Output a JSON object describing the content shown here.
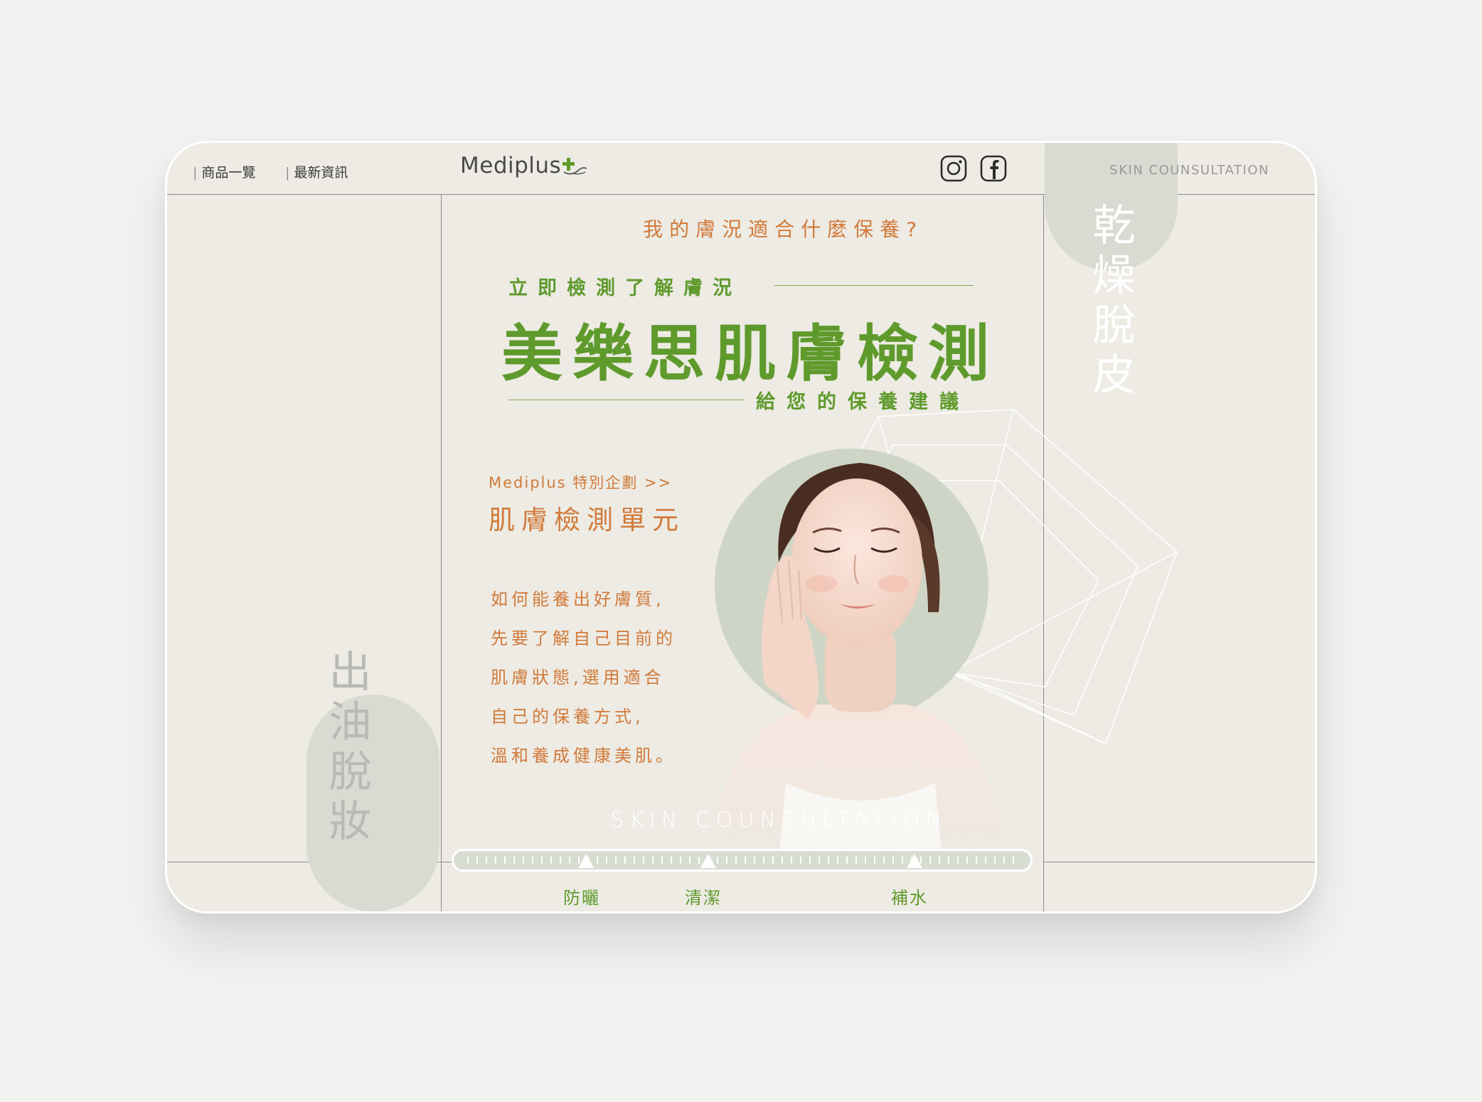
{
  "nav": {
    "items": [
      {
        "label": "商品一覽"
      },
      {
        "label": "最新資訊"
      }
    ],
    "logo": "Mediplus",
    "tagline": "SKIN COUNSULTATION",
    "social": [
      "instagram-icon",
      "facebook-icon"
    ]
  },
  "side": {
    "right_vertical": "乾燥脫皮",
    "left_vertical": "出油脫妝"
  },
  "hero": {
    "question": "我的膚況適合什麼保養?",
    "sub1": "立即檢測了解膚況",
    "title": "美樂思肌膚檢測",
    "sub2": "給您的保養建議"
  },
  "promo": {
    "kicker": "Mediplus 特別企劃 >>",
    "unit": "肌膚檢測單元",
    "lines": [
      "如何能養出好膚質,",
      "先要了解自己目前的",
      "肌膚狀態,選用適合",
      "自己的保養方式,",
      "溫和養成健康美肌。"
    ]
  },
  "bottom": {
    "watermark": "SKIN COUNSULTATION",
    "slider_labels": [
      "防曬",
      "清潔",
      "補水"
    ]
  },
  "colors": {
    "green": "#5f9a2c",
    "orange": "#d17a3a",
    "card": "#edebe4",
    "sage": "#d8dbd1"
  }
}
